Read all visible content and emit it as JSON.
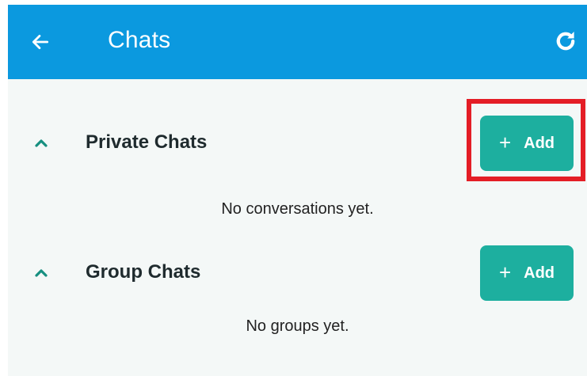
{
  "app_bar": {
    "title": "Chats",
    "back_icon": "arrow-left-icon",
    "refresh_icon": "refresh-icon",
    "background_color": "#0b99df"
  },
  "sections": [
    {
      "title": "Private Chats",
      "collapse_icon": "chevron-up-icon",
      "add_label": "Add",
      "add_icon": "plus-icon",
      "empty_text": "No conversations yet.",
      "highlighted": true
    },
    {
      "title": "Group Chats",
      "collapse_icon": "chevron-up-icon",
      "add_label": "Add",
      "add_icon": "plus-icon",
      "empty_text": "No groups yet.",
      "highlighted": false
    }
  ],
  "colors": {
    "accent": "#1daf9f",
    "highlight": "#e41e26",
    "background": "#f4f8f7"
  }
}
